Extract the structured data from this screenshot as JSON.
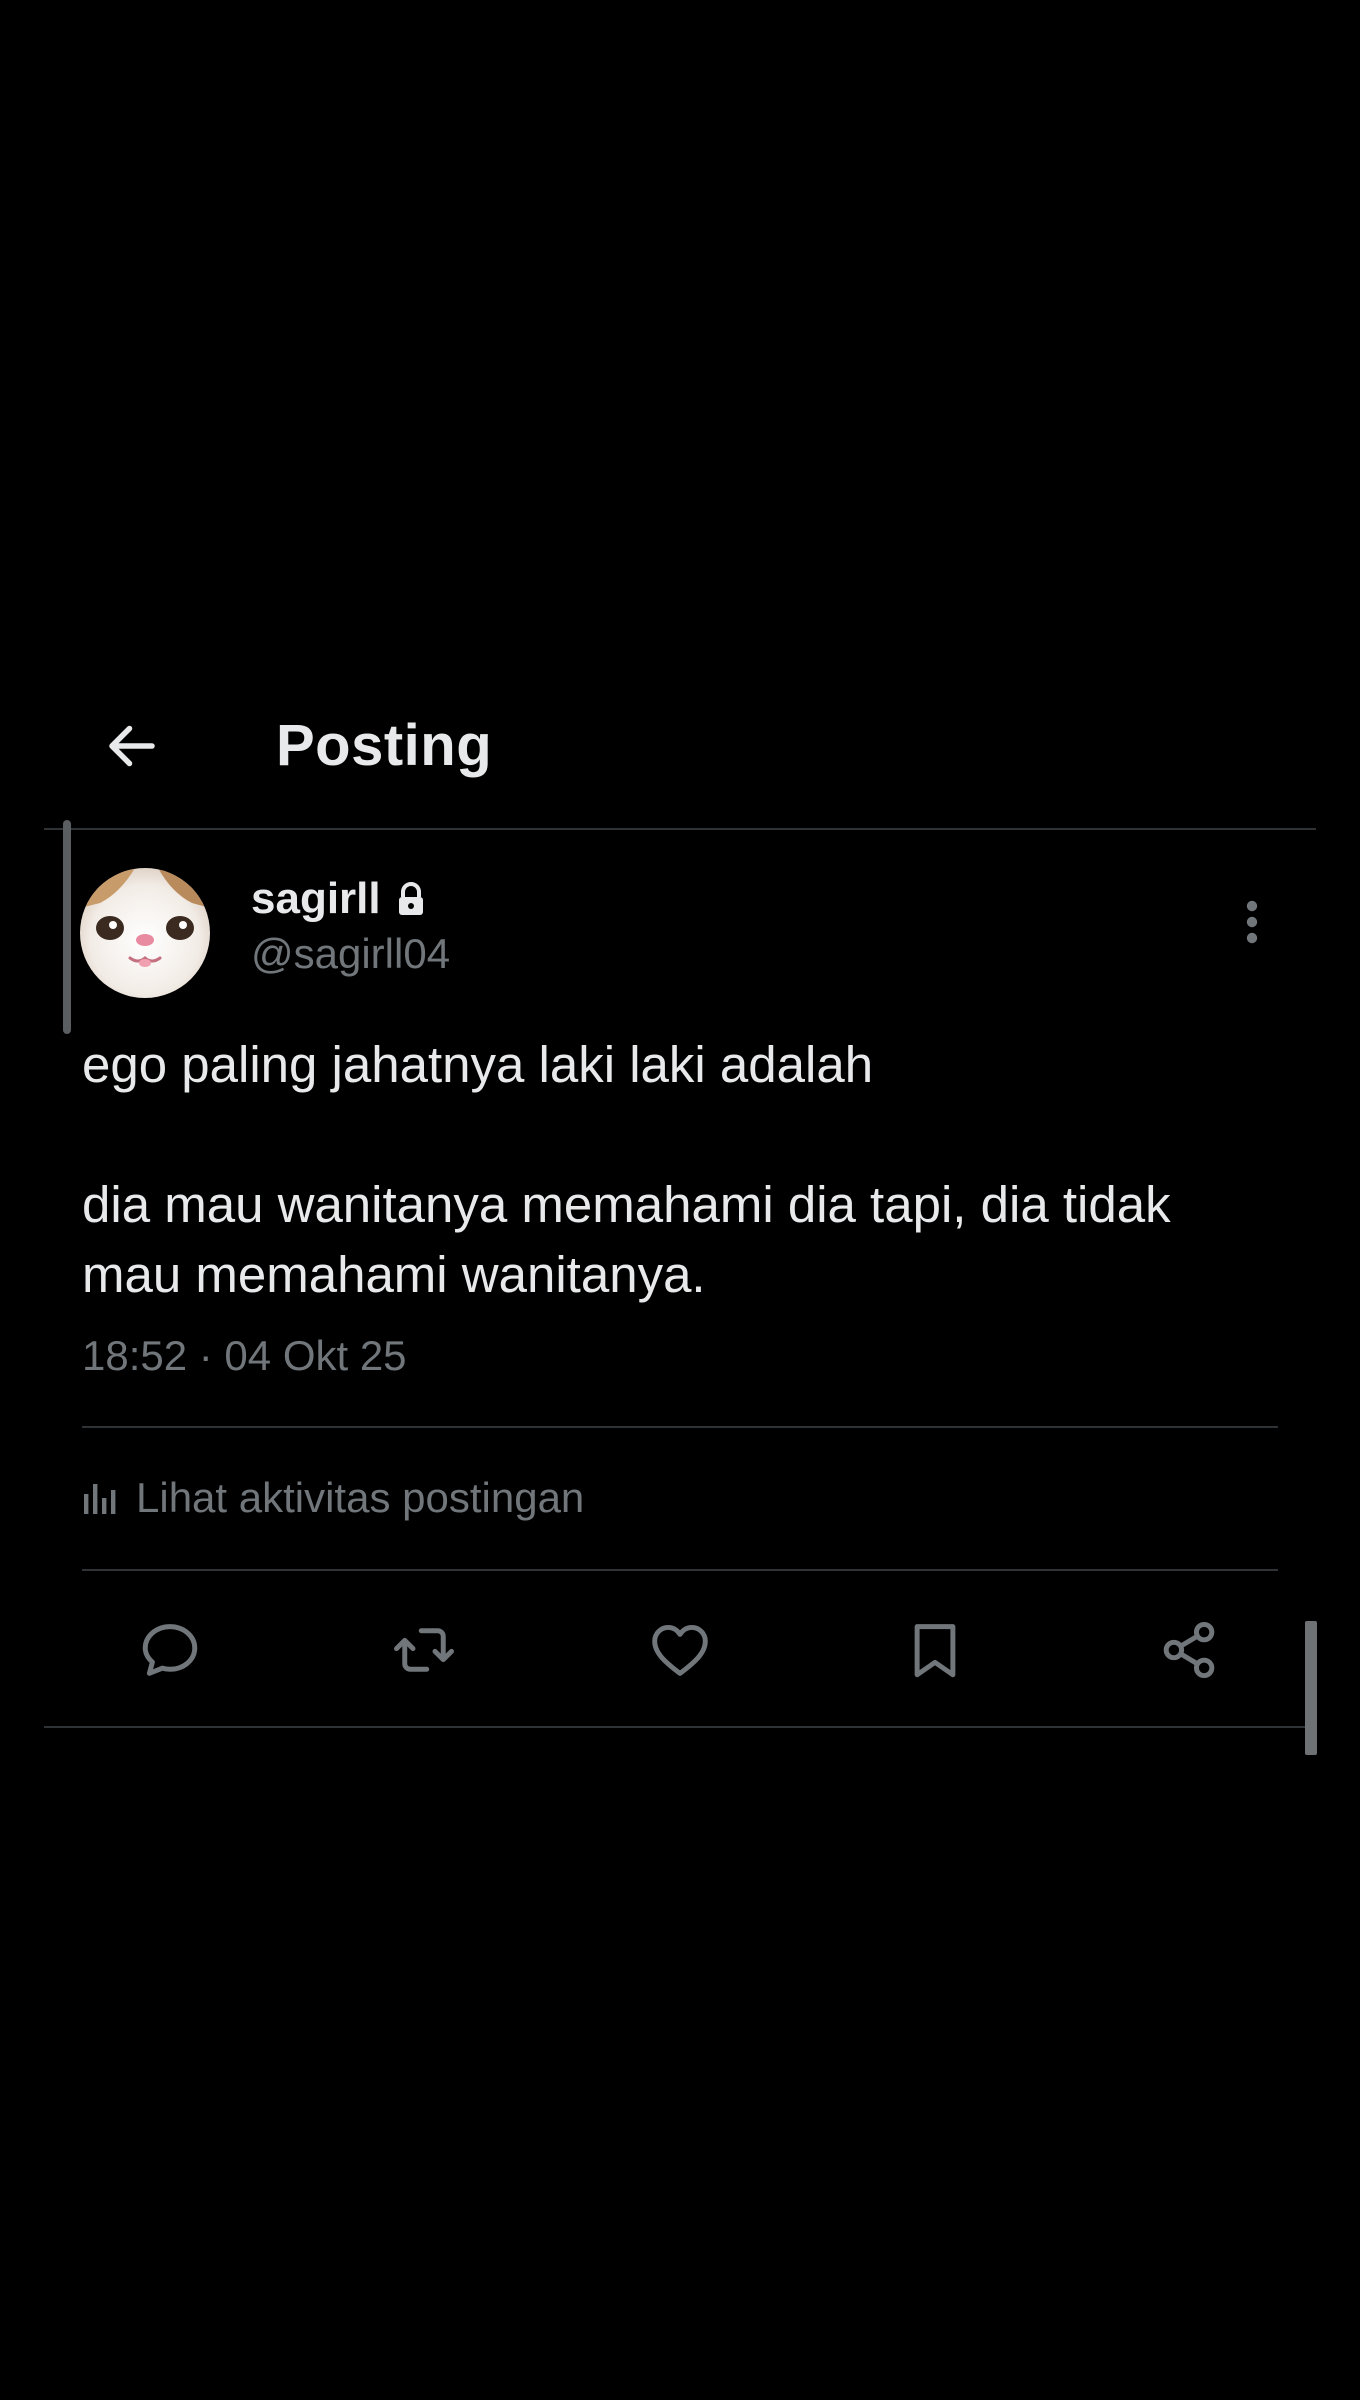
{
  "header": {
    "title": "Posting",
    "back_icon": "arrow-left-icon"
  },
  "post": {
    "author": {
      "display_name": "sagirll",
      "handle": "@sagirll04",
      "protected_icon": "lock-icon",
      "avatar": "cat-avatar"
    },
    "text_line_1": "ego paling jahatnya laki laki adalah",
    "text_line_2": "dia mau wanitanya memahami dia tapi, dia tidak mau memahami wanitanya.",
    "timestamp": "18:52 · 04 Okt 25",
    "activity_label": "Lihat aktivitas postingan",
    "activity_icon": "bar-chart-icon",
    "more_icon": "more-vertical-icon"
  },
  "actions": [
    {
      "name": "reply",
      "icon": "reply-icon"
    },
    {
      "name": "repost",
      "icon": "repost-icon"
    },
    {
      "name": "like",
      "icon": "heart-icon"
    },
    {
      "name": "bookmark",
      "icon": "bookmark-icon"
    },
    {
      "name": "share",
      "icon": "share-icon"
    }
  ],
  "colors": {
    "background": "#000000",
    "primary_text": "#e7e9ea",
    "secondary_text": "#71767b",
    "divider": "#2f3336"
  }
}
